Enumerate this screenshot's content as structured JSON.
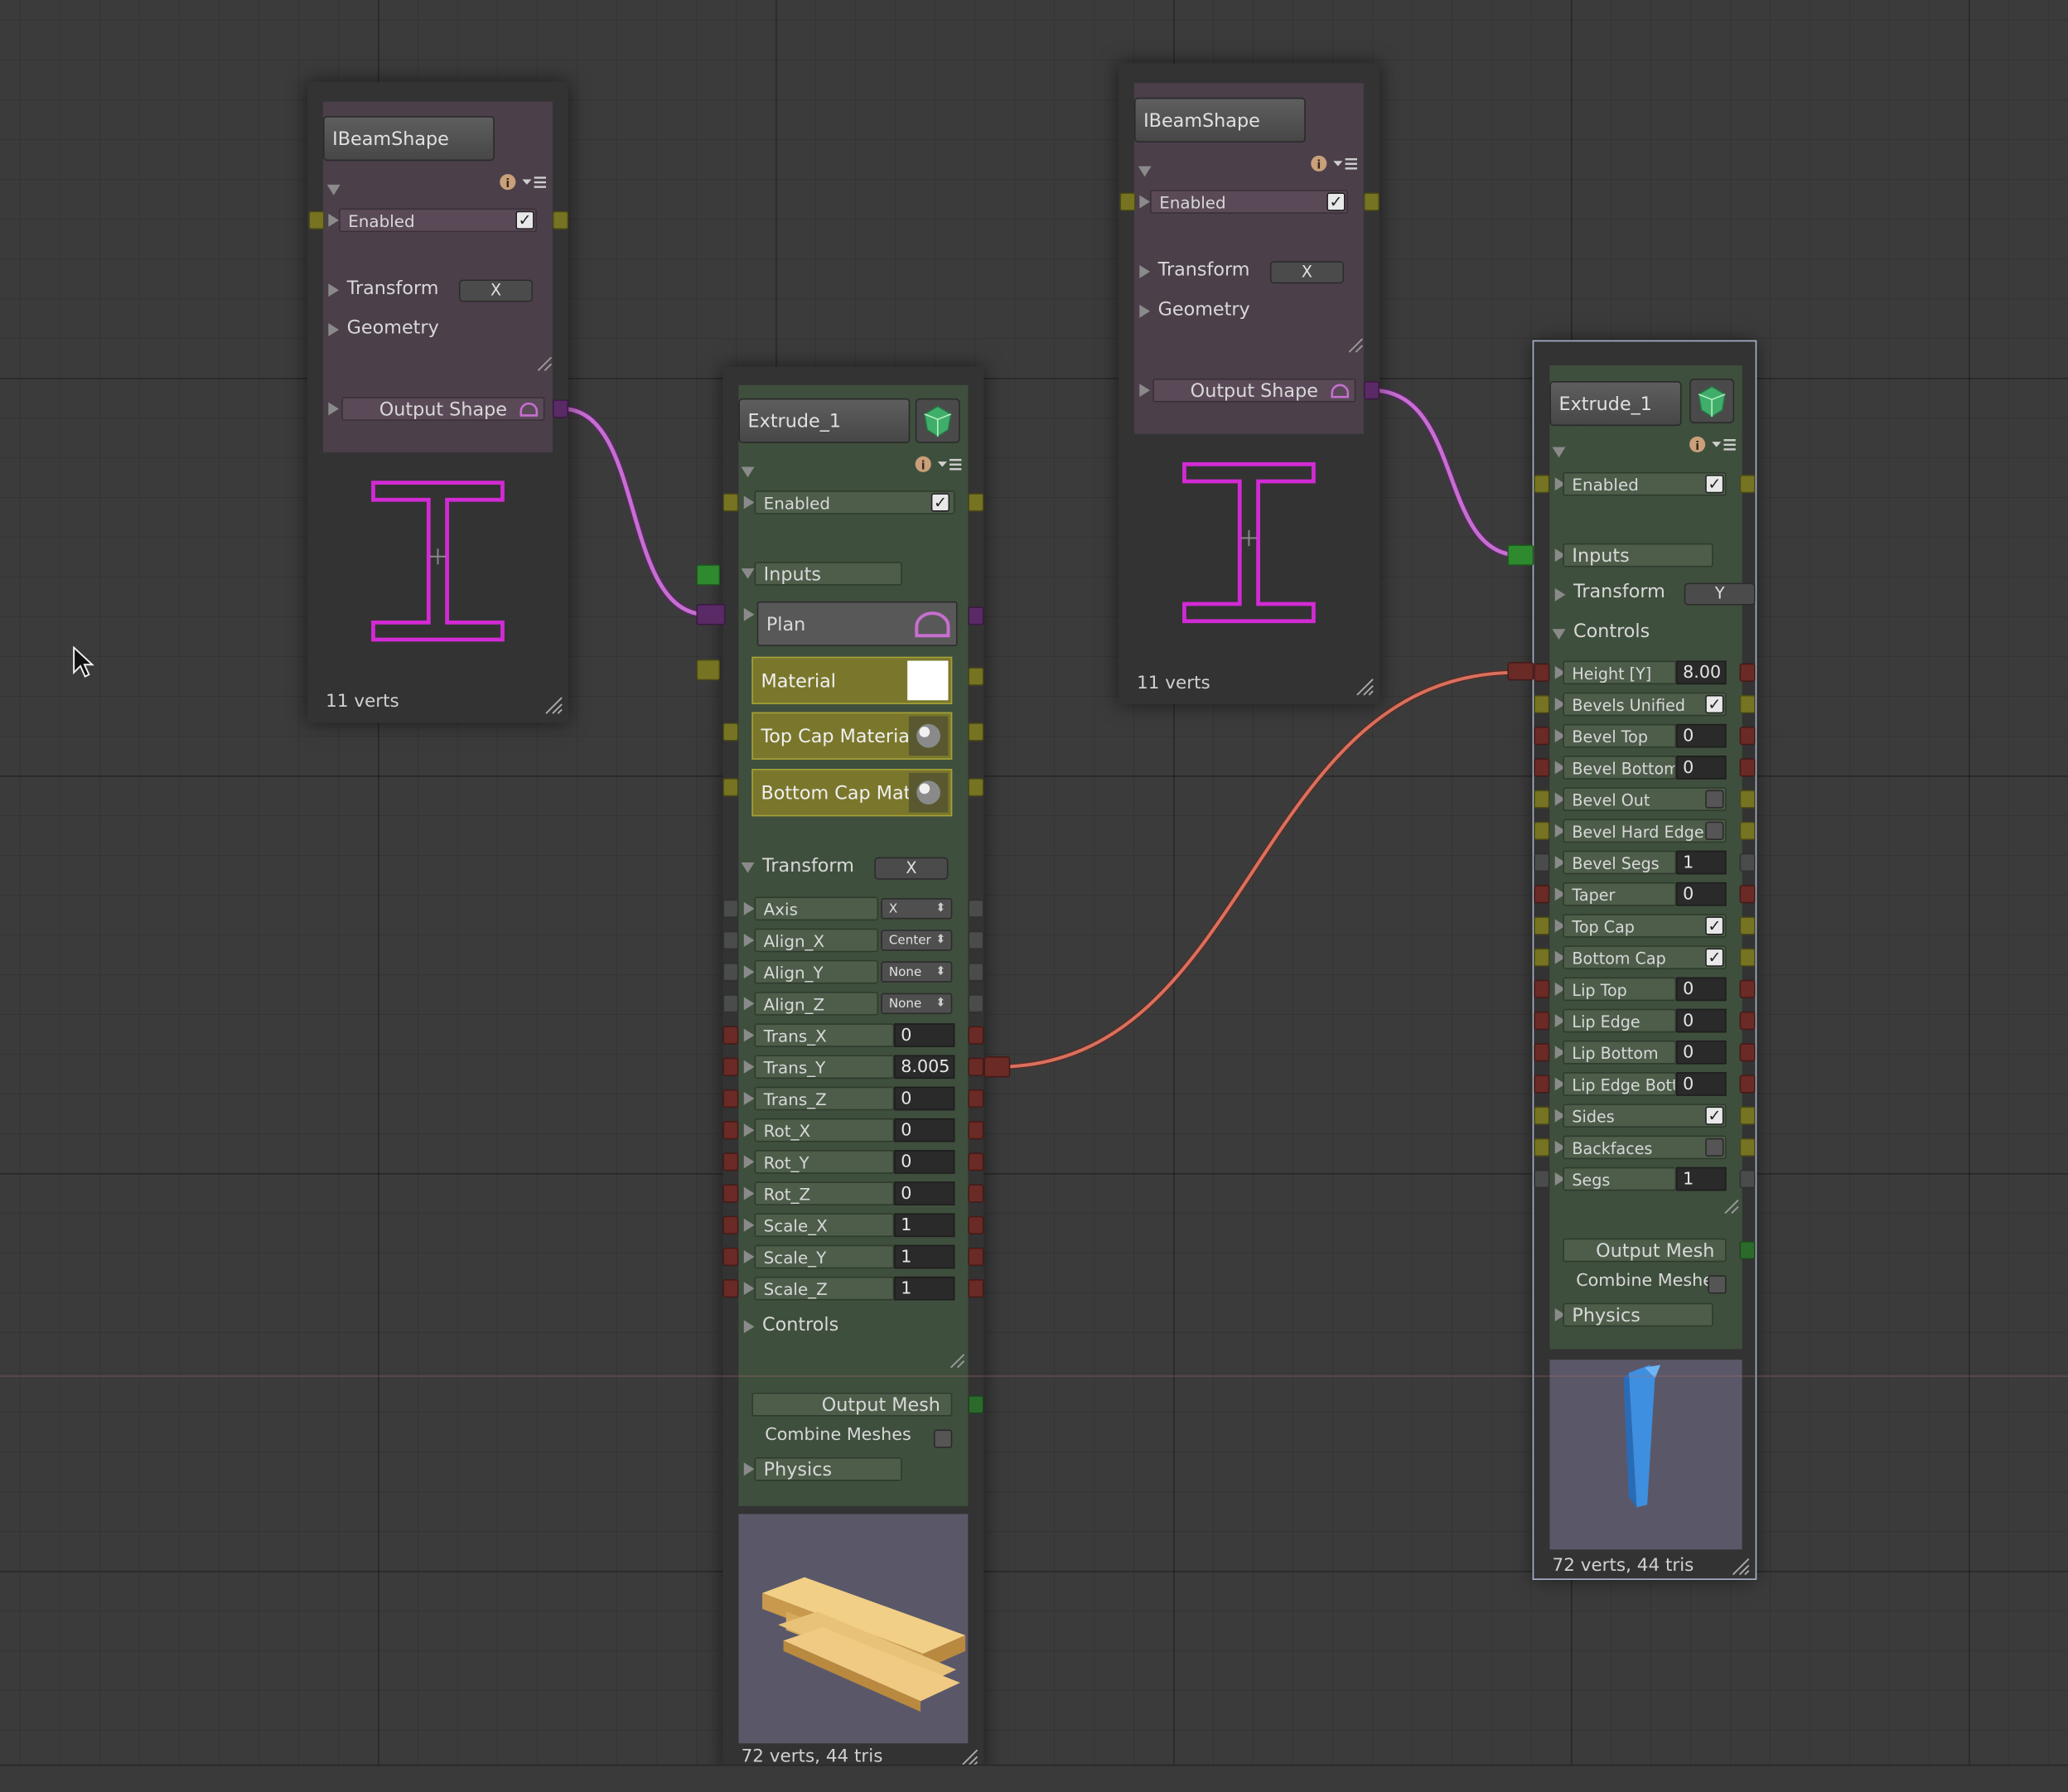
{
  "nodes": {
    "shape_left": {
      "title": "IBeamShape",
      "enabled_label": "Enabled",
      "transform_label": "Transform",
      "transform_axis": "X",
      "geometry_label": "Geometry",
      "output_label": "Output Shape",
      "footer": "11 verts"
    },
    "shape_right": {
      "title": "IBeamShape",
      "enabled_label": "Enabled",
      "transform_label": "Transform",
      "transform_axis": "X",
      "geometry_label": "Geometry",
      "output_label": "Output Shape",
      "footer": "11 verts"
    },
    "extrude_left": {
      "title": "Extrude_1",
      "enabled_label": "Enabled",
      "inputs_label": "Inputs",
      "plan_label": "Plan",
      "material_label": "Material",
      "top_cap_label": "Top Cap Materia",
      "bottom_cap_label": "Bottom Cap Mat",
      "transform_label": "Transform",
      "transform_axis": "X",
      "rows": [
        {
          "label": "Axis",
          "kind": "dropdown",
          "value": "X",
          "port": "d"
        },
        {
          "label": "Align_X",
          "kind": "dropdown",
          "value": "Center",
          "port": "d"
        },
        {
          "label": "Align_Y",
          "kind": "dropdown",
          "value": "None",
          "port": "d"
        },
        {
          "label": "Align_Z",
          "kind": "dropdown",
          "value": "None",
          "port": "d"
        },
        {
          "label": "Trans_X",
          "kind": "number",
          "value": "0",
          "port": "r"
        },
        {
          "label": "Trans_Y",
          "kind": "number",
          "value": "8.005",
          "port": "r"
        },
        {
          "label": "Trans_Z",
          "kind": "number",
          "value": "0",
          "port": "r"
        },
        {
          "label": "Rot_X",
          "kind": "number",
          "value": "0",
          "port": "r"
        },
        {
          "label": "Rot_Y",
          "kind": "number",
          "value": "0",
          "port": "r"
        },
        {
          "label": "Rot_Z",
          "kind": "number",
          "value": "0",
          "port": "r"
        },
        {
          "label": "Scale_X",
          "kind": "number",
          "value": "1",
          "port": "r"
        },
        {
          "label": "Scale_Y",
          "kind": "number",
          "value": "1",
          "port": "r"
        },
        {
          "label": "Scale_Z",
          "kind": "number",
          "value": "1",
          "port": "r"
        }
      ],
      "controls_label": "Controls",
      "output_label": "Output Mesh",
      "combine_label": "Combine Meshes",
      "physics_label": "Physics",
      "footer": "72 verts, 44 tris"
    },
    "extrude_right": {
      "title": "Extrude_1",
      "enabled_label": "Enabled",
      "inputs_label": "Inputs",
      "transform_label": "Transform",
      "transform_axis": "Y",
      "controls_label": "Controls",
      "rows": [
        {
          "label": "Height [Y]",
          "kind": "number",
          "value": "8.00",
          "port": "r"
        },
        {
          "label": "Bevels Unified",
          "kind": "check",
          "checked": true,
          "port": "y"
        },
        {
          "label": "Bevel Top",
          "kind": "number",
          "value": "0",
          "port": "r"
        },
        {
          "label": "Bevel Bottom",
          "kind": "number",
          "value": "0",
          "port": "r"
        },
        {
          "label": "Bevel Out",
          "kind": "check",
          "checked": false,
          "port": "y"
        },
        {
          "label": "Bevel Hard Edge",
          "kind": "check",
          "checked": false,
          "port": "y"
        },
        {
          "label": "Bevel Segs",
          "kind": "number",
          "value": "1",
          "port": "d"
        },
        {
          "label": "Taper",
          "kind": "number",
          "value": "0",
          "port": "r"
        },
        {
          "label": "Top Cap",
          "kind": "check",
          "checked": true,
          "port": "y"
        },
        {
          "label": "Bottom Cap",
          "kind": "check",
          "checked": true,
          "port": "y"
        },
        {
          "label": "Lip Top",
          "kind": "number",
          "value": "0",
          "port": "r"
        },
        {
          "label": "Lip Edge",
          "kind": "number",
          "value": "0",
          "port": "r"
        },
        {
          "label": "Lip Bottom",
          "kind": "number",
          "value": "0",
          "port": "r"
        },
        {
          "label": "Lip Edge Bott",
          "kind": "number",
          "value": "0",
          "port": "r"
        },
        {
          "label": "Sides",
          "kind": "check",
          "checked": true,
          "port": "y"
        },
        {
          "label": "Backfaces",
          "kind": "check",
          "checked": false,
          "port": "y"
        },
        {
          "label": "Segs",
          "kind": "number",
          "value": "1",
          "port": "d"
        }
      ],
      "output_label": "Output Mesh",
      "combine_label": "Combine Meshe",
      "physics_label": "Physics",
      "footer": "72 verts, 44 tris"
    }
  },
  "colors": {
    "canvas": "#3b3b3b",
    "shape_node": "#4b3f4a",
    "extrude_node": "#3f4f3d",
    "shape_wire": "#c76fd0",
    "float_wire": "#d9705e",
    "ibeam_preview": "#d22ad4",
    "mesh_preview_bg": "#5a5868",
    "beam_mesh": "#e7bd6c",
    "column_mesh": "#3f8fe0"
  },
  "icons": [
    "info-icon",
    "menu-icon",
    "mesh-gem-icon",
    "checkmark-icon",
    "resize-grip-icon",
    "plan-shape-icon",
    "sphere-material-icon",
    "mouse-cursor-icon"
  ]
}
